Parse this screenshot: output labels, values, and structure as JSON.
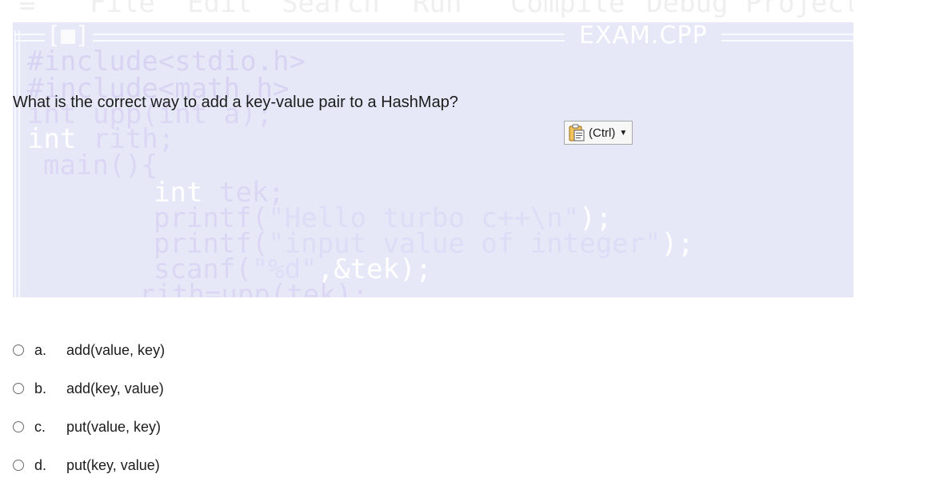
{
  "ide_backdrop": {
    "menu": [
      "≡",
      "File",
      "Edit",
      "Search",
      "Run",
      "Compile",
      "Debug",
      "Project"
    ],
    "window_button": "[■]",
    "title": "EXAM.CPP",
    "code": {
      "line1": "#include<stdio.h>",
      "line2": "#include<math.h>",
      "line3": "int upp(int a);",
      "line4_kw": "int",
      "line4_id": " rith;",
      "line5": "main(){",
      "line6_kw": "int",
      "line6_id": " tek;",
      "line7_fn": "printf(",
      "line7_str": "\"Hello turbo c++\\n\"",
      "line7_end": ");",
      "line8_fn": "printf(",
      "line8_str": "\"input value of integer\"",
      "line8_end": ");",
      "line9_fn": "scanf(",
      "line9_str": "\"%d\"",
      "line9_end": ",&tek);",
      "line10": "rith=upp(tek);"
    }
  },
  "question": {
    "text": "What is the correct way to add a key-value pair to a HashMap?"
  },
  "paste_options": {
    "label": "(Ctrl)",
    "icon": "clipboard-icon"
  },
  "options": [
    {
      "letter": "a.",
      "text": "add(value, key)"
    },
    {
      "letter": "b.",
      "text": "add(key, value)"
    },
    {
      "letter": "c.",
      "text": "put(value, key)"
    },
    {
      "letter": "d.",
      "text": "put(key, value)"
    }
  ],
  "colors": {
    "ide_background": "#e6e8f7",
    "text": "#1c1c1c"
  }
}
